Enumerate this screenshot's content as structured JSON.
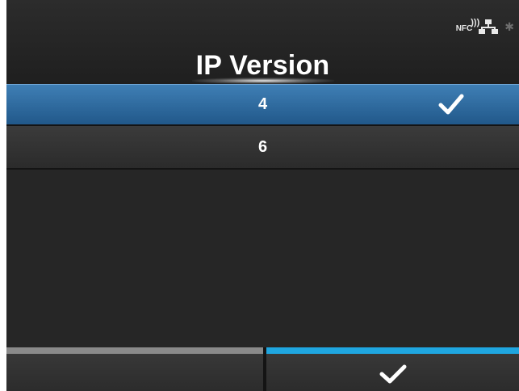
{
  "header": {
    "title": "IP Version",
    "status": {
      "nfc_label": "NFC",
      "icons": [
        "nfc-icon",
        "lan-icon",
        "bluetooth-icon"
      ]
    }
  },
  "options": [
    {
      "label": "4",
      "selected": true,
      "checked": true
    },
    {
      "label": "6",
      "selected": false,
      "checked": false
    }
  ],
  "softkeys": {
    "left": {
      "icon": "none",
      "bar_color": "#8a8a8a"
    },
    "right": {
      "icon": "check-icon",
      "bar_color": "#1fa6e0"
    }
  },
  "colors": {
    "background": "#262626",
    "selection": "#2f6ea3",
    "accent": "#1fa6e0"
  }
}
